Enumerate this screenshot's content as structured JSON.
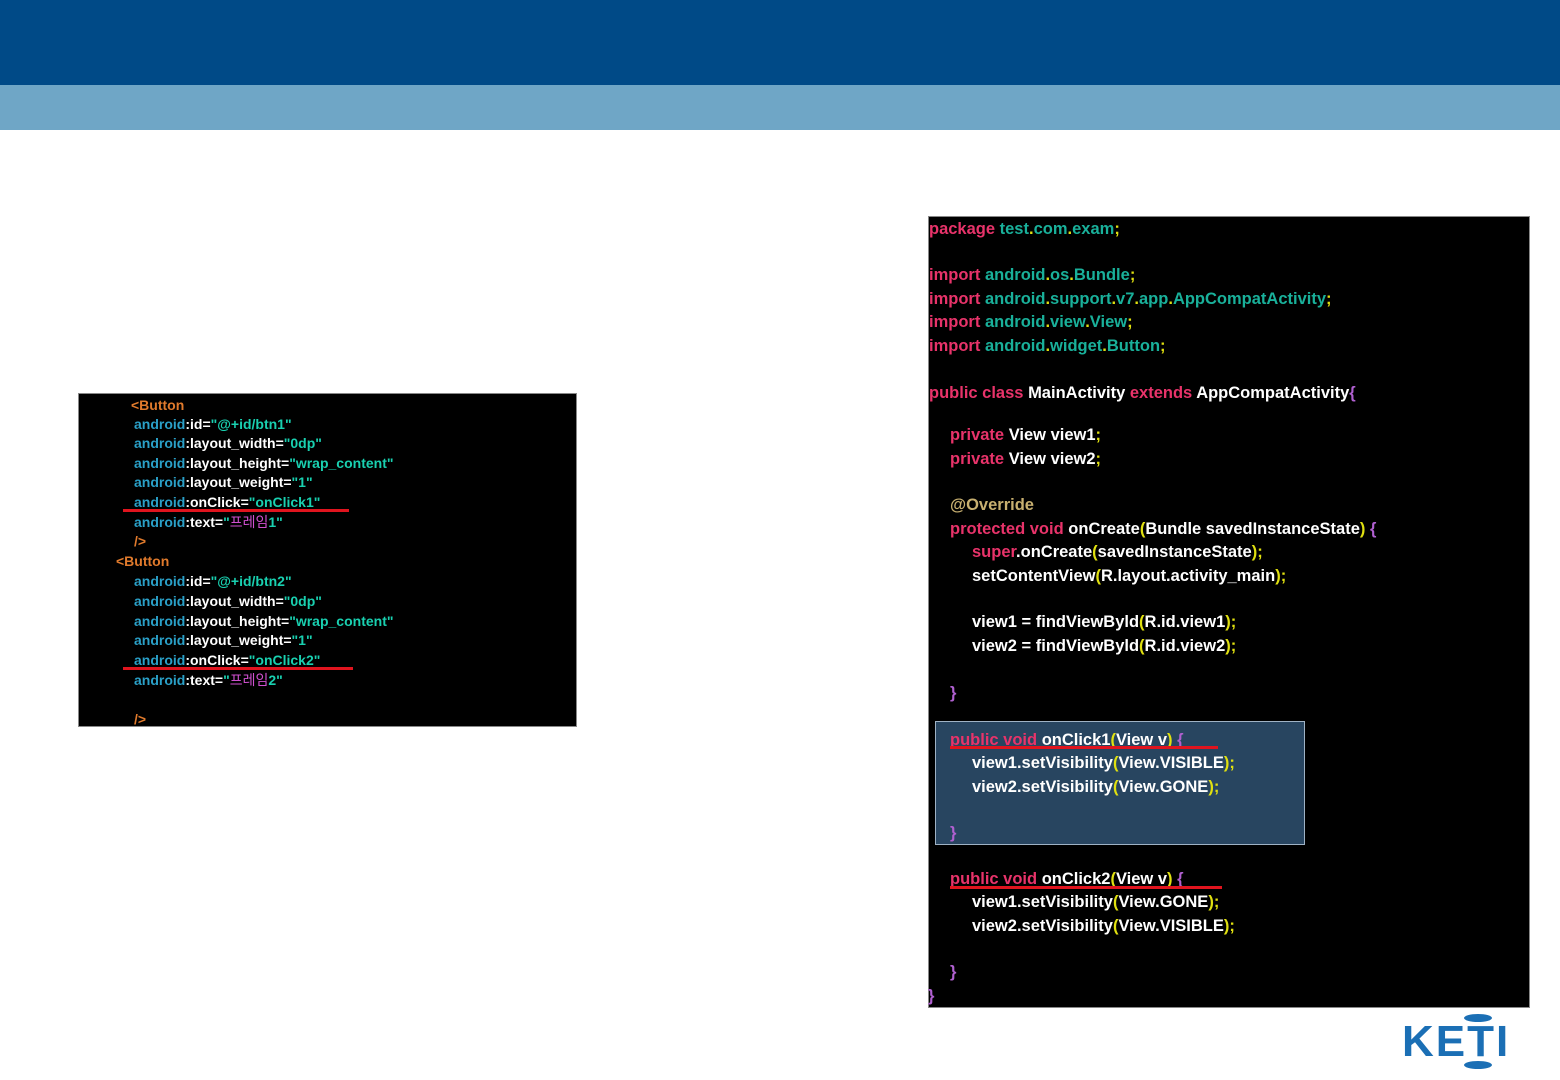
{
  "xml_code": {
    "button1": {
      "open": "<Button",
      "id_ns": "android",
      "id_attr": ":id=",
      "id_val": "\"@+id/btn1\"",
      "width_ns": "android",
      "width_attr": ":layout_width=",
      "width_val": "\"0dp\"",
      "height_ns": "android",
      "height_attr": ":layout_height=",
      "height_val": "\"wrap_content\"",
      "weight_ns": "android",
      "weight_attr": ":layout_weight=",
      "weight_val": "\"1\"",
      "onclick_ns": "android",
      "onclick_attr": ":onClick=",
      "onclick_val": "\"onClick1\"",
      "text_ns": "android",
      "text_attr": ":text=",
      "text_q1": "\"",
      "text_kr": "프레임",
      "text_num": "1\"",
      "close": "/>"
    },
    "button2": {
      "open": "<Button",
      "id_ns": "android",
      "id_attr": ":id=",
      "id_val": "\"@+id/btn2\"",
      "width_ns": "android",
      "width_attr": ":layout_width=",
      "width_val": "\"0dp\"",
      "height_ns": "android",
      "height_attr": ":layout_height=",
      "height_val": "\"wrap_content\"",
      "weight_ns": "android",
      "weight_attr": ":layout_weight=",
      "weight_val": "\"1\"",
      "onclick_ns": "android",
      "onclick_attr": ":onClick=",
      "onclick_val": "\"onClick2\"",
      "text_ns": "android",
      "text_attr": ":text=",
      "text_q1": "\"",
      "text_kr": "프레임",
      "text_num": "2\"",
      "close": "/>"
    }
  },
  "java_code": {
    "pkg_kw": "package",
    "pkg_a": "test",
    "pkg_b": "com",
    "pkg_c": "exam",
    "import_kw": "import",
    "imp1_a": "android",
    "imp1_b": "os",
    "imp1_c": "Bundle",
    "imp2_a": "android",
    "imp2_b": "support",
    "imp2_c": "v7",
    "imp2_d": "app",
    "imp2_e": "AppCompatActivity",
    "imp3_a": "android",
    "imp3_b": "view",
    "imp3_c": "View",
    "imp4_a": "android",
    "imp4_b": "widget",
    "imp4_c": "Button",
    "class_kw": "public class",
    "class_name": "MainActivity",
    "extends_kw": "extends",
    "super_name": "AppCompatActivity",
    "private_kw": "private",
    "field1": "View view1",
    "field2": "View view2",
    "annotation": "@Override",
    "oncreate_kw": "protected void",
    "oncreate_sig": "onCreate",
    "oncreate_params": "Bundle savedInstanceState",
    "super_kw": "super",
    "super_call": ".onCreate",
    "super_args": "savedInstanceState",
    "set_content": "setContentView",
    "set_content_args": "R.layout.activity_main",
    "v1_assign": "view1 = findViewByld",
    "v1_args": "R.id.view1",
    "v2_assign": "view2 = findViewByld",
    "v2_args": "R.id.view2",
    "method_kw": "public void",
    "m1_name": "onClick1",
    "m1_params": "View v",
    "m1_line1": "view1.setVisibility",
    "m1_line1_arg": "View.VISIBLE",
    "m1_line2": "view2.setVisibility",
    "m1_line2_arg": "View.GONE",
    "m2_name": "onClick2",
    "m2_params": "View v",
    "m2_line1": "view1.setVisibility",
    "m2_line1_arg": "View.GONE",
    "m2_line2": "view2.setVisibility",
    "m2_line2_arg": "View.VISIBLE",
    "open_brace": "{",
    "close_brace": "}",
    "semi": ";",
    "dot": ".",
    "lparen": "(",
    "rparen": ")"
  },
  "logo": {
    "text": "KETI"
  },
  "colors": {
    "header_dark": "#004a87",
    "header_light": "#6fa6c6",
    "logo_blue": "#1b6fb5",
    "underline_red": "#e0141e"
  }
}
